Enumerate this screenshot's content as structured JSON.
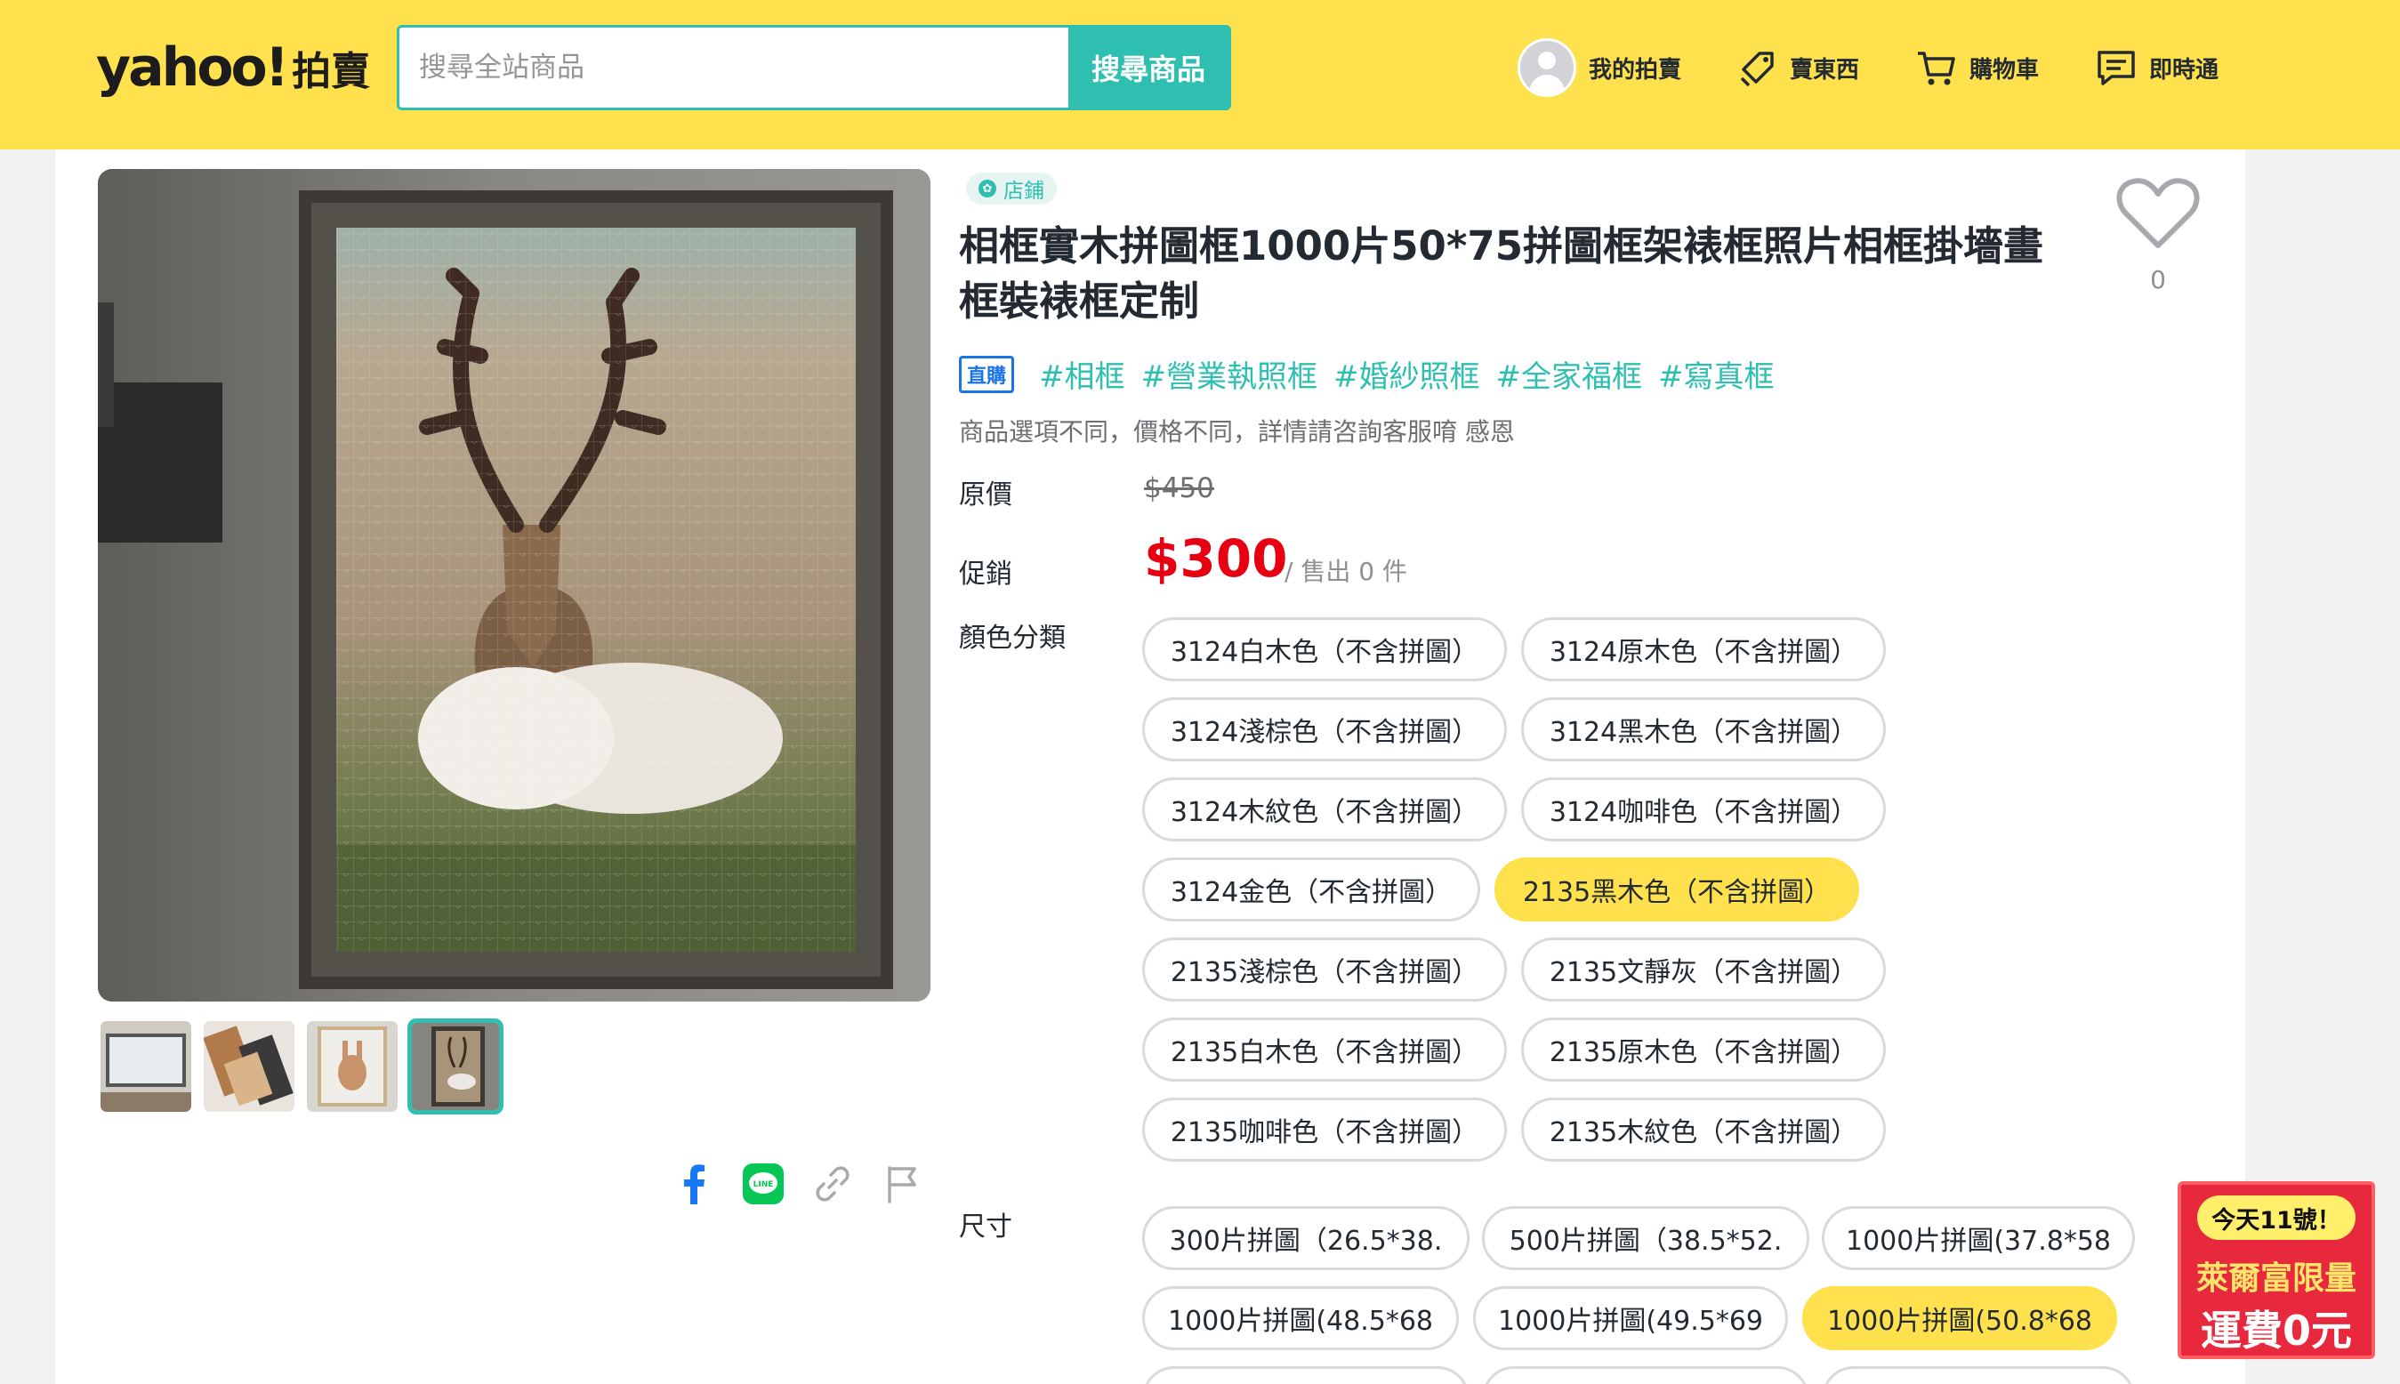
{
  "header": {
    "logo_text": "yahoo!",
    "logo_sub": "拍賣",
    "search_placeholder": "搜尋全站商品",
    "search_button": "搜尋商品",
    "nav": [
      "我的拍賣",
      "賣東西",
      "購物車",
      "即時通"
    ]
  },
  "product": {
    "store_badge": "店鋪",
    "title": "相框實木拼圖框1000片50*75拼圖框架裱框照片相框掛墻畫框裝裱框定制",
    "favorite_count": "0",
    "direct_badge": "直購",
    "tags": [
      "#相框",
      "#營業執照框",
      "#婚紗照框",
      "#全家福框",
      "#寫真框"
    ],
    "note": "商品選項不同，價格不同，詳情請咨詢客服唷 感恩",
    "original_price_label": "原價",
    "original_price": "$450",
    "sale_price_label": "促銷",
    "sale_price": "$300",
    "sold_text": "/ 售出 0 件",
    "color_label": "顏色分類",
    "colors": [
      "3124白木色（不含拼圖）",
      "3124原木色（不含拼圖）",
      "3124淺棕色（不含拼圖）",
      "3124黑木色（不含拼圖）",
      "3124木紋色（不含拼圖）",
      "3124咖啡色（不含拼圖）",
      "3124金色（不含拼圖）",
      "2135黑木色（不含拼圖）",
      "2135淺棕色（不含拼圖）",
      "2135文靜灰（不含拼圖）",
      "2135白木色（不含拼圖）",
      "2135原木色（不含拼圖）",
      "2135咖啡色（不含拼圖）",
      "2135木紋色（不含拼圖）"
    ],
    "selected_color": "2135黑木色（不含拼圖）",
    "size_label": "尺寸",
    "sizes": [
      "300片拼圖（26.5*38.",
      "500片拼圖（38.5*52.",
      "1000片拼圖(37.8*58",
      "1000片拼圖(48.5*68",
      "1000片拼圖(49.5*69",
      "1000片拼圖(50.8*68"
    ],
    "selected_size": "1000片拼圖(50.8*68"
  },
  "promo": {
    "top": "今天11號！",
    "line1": "萊爾富限量",
    "line2": "運費0元"
  },
  "colors": {
    "brand_yellow": "#ffe14d",
    "teal": "#2fbfb1",
    "price_red": "#e60012"
  }
}
